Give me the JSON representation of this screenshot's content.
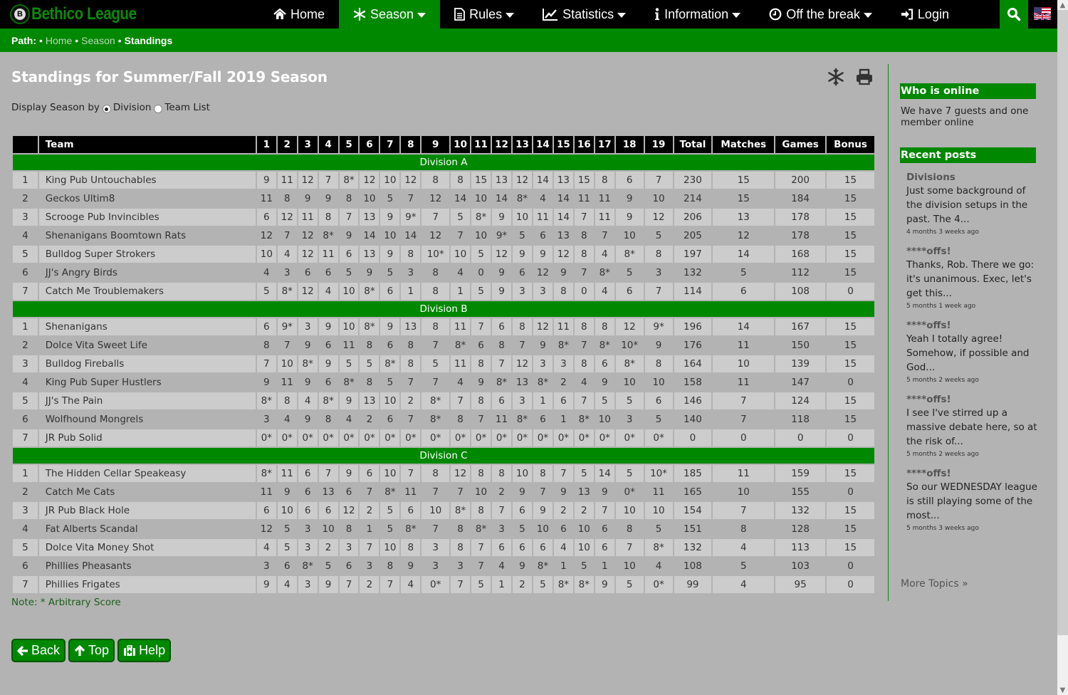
{
  "brand": {
    "name": "Bethico League",
    "logo_letter": "B"
  },
  "nav": [
    {
      "label": "Home",
      "icon": "home-icon",
      "dropdown": false,
      "active": false
    },
    {
      "label": "Season",
      "icon": "snowflake-icon",
      "dropdown": true,
      "active": true
    },
    {
      "label": "Rules",
      "icon": "document-icon",
      "dropdown": true,
      "active": false
    },
    {
      "label": "Statistics",
      "icon": "chart-icon",
      "dropdown": true,
      "active": false
    },
    {
      "label": "Information",
      "icon": "info-icon",
      "dropdown": true,
      "active": false
    },
    {
      "label": "Off the break",
      "icon": "clock-icon",
      "dropdown": true,
      "active": false
    },
    {
      "label": "Login",
      "icon": "login-icon",
      "dropdown": false,
      "active": false
    }
  ],
  "path": {
    "label": "Path:",
    "items": [
      "Home",
      "Season"
    ],
    "current": "Standings"
  },
  "page": {
    "title": "Standings for Summer/Fall 2019 Season",
    "display_by_label": "Display Season by",
    "options": [
      {
        "label": "Division",
        "checked": true
      },
      {
        "label": "Team List",
        "checked": false
      }
    ],
    "note": "Note: * Arbitrary Score"
  },
  "table": {
    "headers": [
      "",
      "Team",
      "1",
      "2",
      "3",
      "4",
      "5",
      "6",
      "7",
      "8",
      "9",
      "10",
      "11",
      "12",
      "13",
      "14",
      "15",
      "16",
      "17",
      "18",
      "19",
      "Total",
      "Matches",
      "Games",
      "Bonus"
    ],
    "divisions": [
      {
        "name": "Division A",
        "rows": [
          {
            "pos": "1",
            "team": "King Pub Untouchables",
            "scores": [
              "9",
              "11",
              "12",
              "7",
              "8*",
              "12",
              "10",
              "12",
              "8",
              "8",
              "15",
              "13",
              "12",
              "14",
              "13",
              "15",
              "8",
              "6",
              "7"
            ],
            "total": "230",
            "matches": "15",
            "games": "200",
            "bonus": "15"
          },
          {
            "pos": "2",
            "team": "Geckos Ultim8",
            "scores": [
              "11",
              "8",
              "9",
              "9",
              "8",
              "10",
              "5",
              "7",
              "12",
              "14",
              "10",
              "14",
              "8*",
              "4",
              "14",
              "11",
              "11",
              "9",
              "10"
            ],
            "total": "214",
            "matches": "15",
            "games": "184",
            "bonus": "15"
          },
          {
            "pos": "3",
            "team": "Scrooge Pub Invincibles",
            "scores": [
              "6",
              "12",
              "11",
              "8",
              "7",
              "13",
              "9",
              "9*",
              "7",
              "5",
              "8*",
              "9",
              "10",
              "11",
              "14",
              "7",
              "11",
              "9",
              "12"
            ],
            "total": "206",
            "matches": "13",
            "games": "178",
            "bonus": "15"
          },
          {
            "pos": "4",
            "team": "Shenanigans Boomtown Rats",
            "scores": [
              "12",
              "7",
              "12",
              "8*",
              "9",
              "14",
              "10",
              "14",
              "12",
              "7",
              "10",
              "9*",
              "5",
              "6",
              "13",
              "8",
              "7",
              "10",
              "5"
            ],
            "total": "205",
            "matches": "12",
            "games": "178",
            "bonus": "15"
          },
          {
            "pos": "5",
            "team": "Bulldog Super Strokers",
            "scores": [
              "10",
              "4",
              "12",
              "11",
              "6",
              "13",
              "9",
              "8",
              "10*",
              "10",
              "5",
              "12",
              "9",
              "9",
              "12",
              "8",
              "4",
              "8*",
              "8"
            ],
            "total": "197",
            "matches": "14",
            "games": "168",
            "bonus": "15"
          },
          {
            "pos": "6",
            "team": "JJ's Angry Birds",
            "scores": [
              "4",
              "3",
              "6",
              "6",
              "5",
              "9",
              "5",
              "3",
              "8",
              "4",
              "0",
              "9",
              "6",
              "12",
              "9",
              "7",
              "8*",
              "5",
              "3"
            ],
            "total": "132",
            "matches": "5",
            "games": "112",
            "bonus": "15"
          },
          {
            "pos": "7",
            "team": "Catch Me Troublemakers",
            "scores": [
              "5",
              "8*",
              "12",
              "4",
              "10",
              "8*",
              "6",
              "1",
              "8",
              "1",
              "5",
              "9",
              "3",
              "3",
              "8",
              "0",
              "4",
              "6",
              "7"
            ],
            "total": "114",
            "matches": "6",
            "games": "108",
            "bonus": "0"
          }
        ]
      },
      {
        "name": "Division B",
        "rows": [
          {
            "pos": "1",
            "team": "Shenanigans",
            "scores": [
              "6",
              "9*",
              "3",
              "9",
              "10",
              "8*",
              "9",
              "13",
              "8",
              "11",
              "7",
              "6",
              "8",
              "12",
              "11",
              "8",
              "8",
              "12",
              "9*"
            ],
            "total": "196",
            "matches": "14",
            "games": "167",
            "bonus": "15"
          },
          {
            "pos": "2",
            "team": "Dolce Vita Sweet Life",
            "scores": [
              "8",
              "7",
              "9",
              "6",
              "11",
              "8",
              "6",
              "8",
              "7",
              "8*",
              "6",
              "8",
              "7",
              "9",
              "8*",
              "7",
              "8*",
              "10*",
              "9"
            ],
            "total": "176",
            "matches": "11",
            "games": "150",
            "bonus": "15"
          },
          {
            "pos": "3",
            "team": "Bulldog Fireballs",
            "scores": [
              "7",
              "10",
              "8*",
              "9",
              "5",
              "5",
              "8*",
              "8",
              "5",
              "11",
              "8",
              "7",
              "12",
              "3",
              "3",
              "8",
              "6",
              "8*",
              "8"
            ],
            "total": "164",
            "matches": "10",
            "games": "139",
            "bonus": "15"
          },
          {
            "pos": "4",
            "team": "King Pub Super Hustlers",
            "scores": [
              "9",
              "11",
              "9",
              "6",
              "8*",
              "8",
              "5",
              "7",
              "7",
              "4",
              "9",
              "8*",
              "13",
              "8*",
              "2",
              "4",
              "9",
              "10",
              "10"
            ],
            "total": "158",
            "matches": "11",
            "games": "147",
            "bonus": "0"
          },
          {
            "pos": "5",
            "team": "JJ's The Pain",
            "scores": [
              "8*",
              "8",
              "4",
              "8*",
              "9",
              "13",
              "10",
              "2",
              "8*",
              "7",
              "8",
              "6",
              "3",
              "1",
              "6",
              "7",
              "5",
              "5",
              "6"
            ],
            "total": "146",
            "matches": "7",
            "games": "124",
            "bonus": "15"
          },
          {
            "pos": "6",
            "team": "Wolfhound Mongrels",
            "scores": [
              "3",
              "4",
              "9",
              "8",
              "4",
              "2",
              "6",
              "7",
              "8*",
              "8",
              "7",
              "11",
              "8*",
              "6",
              "1",
              "8*",
              "10",
              "3",
              "5"
            ],
            "total": "140",
            "matches": "7",
            "games": "118",
            "bonus": "15"
          },
          {
            "pos": "7",
            "team": "JR Pub Solid",
            "scores": [
              "0*",
              "0*",
              "0*",
              "0*",
              "0*",
              "0*",
              "0*",
              "0*",
              "0*",
              "0*",
              "0*",
              "0*",
              "0*",
              "0*",
              "0*",
              "0*",
              "0*",
              "0*",
              "0*"
            ],
            "total": "0",
            "matches": "0",
            "games": "0",
            "bonus": "0"
          }
        ]
      },
      {
        "name": "Division C",
        "rows": [
          {
            "pos": "1",
            "team": "The Hidden Cellar Speakeasy",
            "scores": [
              "8*",
              "11",
              "6",
              "7",
              "9",
              "6",
              "10",
              "7",
              "8",
              "12",
              "8",
              "8",
              "10",
              "8",
              "7",
              "5",
              "14",
              "5",
              "10*"
            ],
            "total": "185",
            "matches": "11",
            "games": "159",
            "bonus": "15"
          },
          {
            "pos": "2",
            "team": "Catch Me Cats",
            "scores": [
              "11",
              "9",
              "6",
              "13",
              "6",
              "7",
              "8*",
              "11",
              "7",
              "7",
              "10",
              "2",
              "9",
              "7",
              "9",
              "13",
              "9",
              "0*",
              "11"
            ],
            "total": "165",
            "matches": "10",
            "games": "155",
            "bonus": "0"
          },
          {
            "pos": "3",
            "team": "JR Pub Black Hole",
            "scores": [
              "6",
              "10",
              "6",
              "6",
              "12",
              "2",
              "5",
              "6",
              "10",
              "8*",
              "8",
              "7",
              "6",
              "9",
              "2",
              "2",
              "7",
              "10",
              "10"
            ],
            "total": "154",
            "matches": "7",
            "games": "132",
            "bonus": "15"
          },
          {
            "pos": "4",
            "team": "Fat Alberts Scandal",
            "scores": [
              "12",
              "5",
              "3",
              "10",
              "8",
              "1",
              "5",
              "8*",
              "7",
              "8",
              "8*",
              "3",
              "5",
              "10",
              "6",
              "10",
              "6",
              "8",
              "5"
            ],
            "total": "151",
            "matches": "8",
            "games": "128",
            "bonus": "15"
          },
          {
            "pos": "5",
            "team": "Dolce Vita Money Shot",
            "scores": [
              "4",
              "5",
              "3",
              "2",
              "3",
              "7",
              "10",
              "8",
              "3",
              "8",
              "7",
              "6",
              "6",
              "6",
              "4",
              "10",
              "6",
              "7",
              "8*"
            ],
            "total": "132",
            "matches": "4",
            "games": "113",
            "bonus": "15"
          },
          {
            "pos": "6",
            "team": "Phillies Pheasants",
            "scores": [
              "3",
              "6",
              "8*",
              "5",
              "6",
              "3",
              "8",
              "9",
              "3",
              "3",
              "7",
              "4",
              "9",
              "8*",
              "1",
              "5",
              "1",
              "10",
              "4"
            ],
            "total": "108",
            "matches": "5",
            "games": "103",
            "bonus": "0"
          },
          {
            "pos": "7",
            "team": "Phillies Frigates",
            "scores": [
              "9",
              "4",
              "3",
              "9",
              "7",
              "2",
              "7",
              "4",
              "0*",
              "7",
              "5",
              "1",
              "2",
              "5",
              "8*",
              "8*",
              "9",
              "5",
              "0*"
            ],
            "total": "99",
            "matches": "4",
            "games": "95",
            "bonus": "0"
          }
        ]
      }
    ]
  },
  "buttons": [
    {
      "label": "Back",
      "icon": "arrow-left-icon"
    },
    {
      "label": "Top",
      "icon": "arrow-up-icon"
    },
    {
      "label": "Help",
      "icon": "medkit-icon"
    }
  ],
  "sidebar": {
    "online": {
      "title": "Who is online",
      "text": "We have 7 guests and one member online"
    },
    "recent": {
      "title": "Recent posts",
      "posts": [
        {
          "title": "Divisions",
          "body": "Just some background of the division setups in the past. The 4...",
          "date": "4 months 3 weeks ago"
        },
        {
          "title": "****offs!",
          "body": "Thanks, Rob. There we go: it's unanimous. Exec, let's get this...",
          "date": "5 months 1 week ago"
        },
        {
          "title": "****offs!",
          "body": "Yeah I totally agree! Somehow, if possible and God...",
          "date": "5 months 2 weeks ago"
        },
        {
          "title": "****offs!",
          "body": "I see I've stirred up a massive debate here, so at the risk of...",
          "date": "5 months 2 weeks ago"
        },
        {
          "title": "****offs!",
          "body": "So our WEDNESDAY league is still playing some of the most...",
          "date": "5 months 3 weeks ago"
        }
      ],
      "more": "More Topics »"
    }
  },
  "colors": {
    "brand_green": "#008800",
    "nav_bg": "#000000",
    "page_bg": "#b3b3b3",
    "row_light": "#cccccc"
  }
}
